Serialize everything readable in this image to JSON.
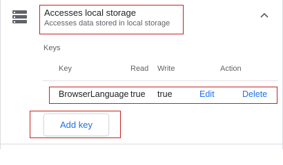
{
  "header": {
    "title": "Accesses local storage",
    "subtitle": "Accesses data stored in local storage",
    "icons": {
      "leading": "storage-icon",
      "toggle": "chevron-up-icon"
    }
  },
  "keys": {
    "section_label": "Keys",
    "columns": [
      "Key",
      "Read",
      "Write",
      "Action"
    ],
    "rows": [
      {
        "key": "BrowserLanguage",
        "read": "true",
        "write": "true",
        "edit_label": "Edit",
        "delete_label": "Delete"
      }
    ]
  },
  "add_button": {
    "label": "Add key"
  },
  "colors": {
    "accent": "#1a73e8",
    "highlight_border": "#c5221f",
    "secondary_text": "#5f6368"
  }
}
